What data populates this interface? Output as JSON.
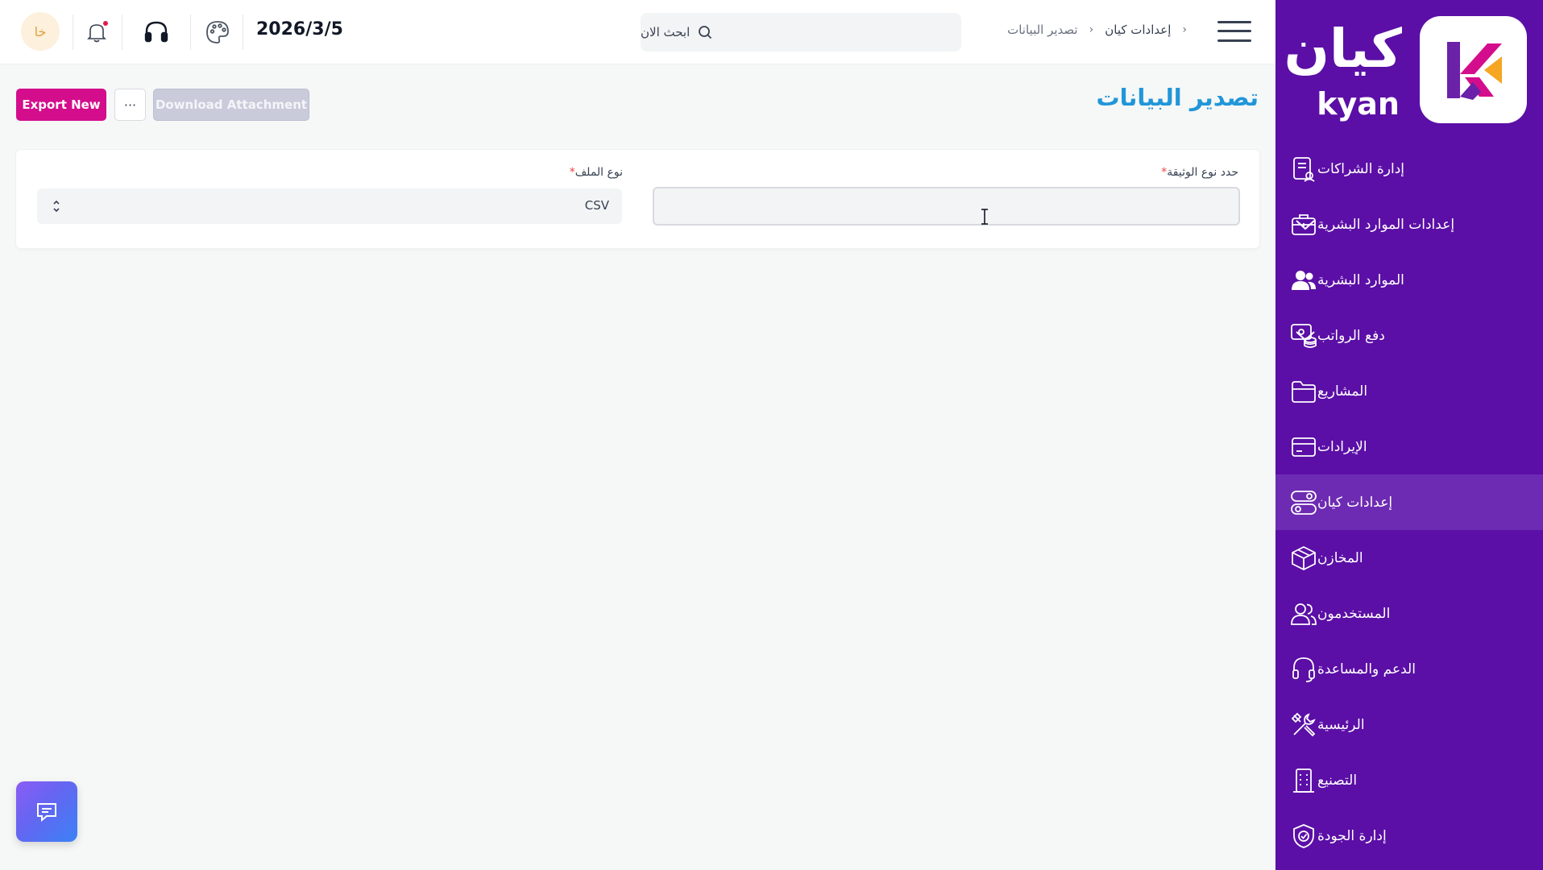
{
  "brand": {
    "name_ar": "كيان",
    "name_en": "kyan",
    "colors": {
      "sidebar": "#5b0fa6",
      "active_item": "#6d2bb3",
      "accent_pink": "#d40d8c",
      "accent_orange": "#f5a623",
      "title_blue": "#2196d9"
    }
  },
  "sidebar": {
    "items": [
      {
        "label": "إدارة الشراكات",
        "icon": "document-user-icon",
        "expandable": false,
        "active": false
      },
      {
        "label": "إعدادات الموارد البشرية",
        "icon": "briefcase-icon",
        "expandable": true,
        "active": false
      },
      {
        "label": "الموارد البشرية",
        "icon": "users-icon",
        "expandable": false,
        "active": false
      },
      {
        "label": "دفع الرواتب",
        "icon": "payroll-icon",
        "expandable": true,
        "active": false
      },
      {
        "label": "المشاريع",
        "icon": "folder-icon",
        "expandable": false,
        "active": false
      },
      {
        "label": "الإيرادات",
        "icon": "credit-card-icon",
        "expandable": false,
        "active": false
      },
      {
        "label": "إعدادات كيان",
        "icon": "toggles-icon",
        "expandable": false,
        "active": true
      },
      {
        "label": "المخازن",
        "icon": "box-icon",
        "expandable": false,
        "active": false
      },
      {
        "label": "المستخدمون",
        "icon": "user-group-icon",
        "expandable": false,
        "active": false
      },
      {
        "label": "الدعم والمساعدة",
        "icon": "headset-icon",
        "expandable": false,
        "active": false
      },
      {
        "label": "الرئيسية",
        "icon": "tools-icon",
        "expandable": false,
        "active": false
      },
      {
        "label": "التصنيع",
        "icon": "building-icon",
        "expandable": false,
        "active": false
      },
      {
        "label": "إدارة الجودة",
        "icon": "shield-check-icon",
        "expandable": false,
        "active": false
      }
    ]
  },
  "topbar": {
    "breadcrumb": {
      "parent": "إعدادات كيان",
      "current": "تصدير البيانات"
    },
    "search": {
      "placeholder": "ابحث الان"
    },
    "date": "2026/3/5",
    "avatar_initials": "خا"
  },
  "page": {
    "title": "تصدير البيانات",
    "export_new_label": "Export New",
    "more_label": "···",
    "download_label": "Download Attachment"
  },
  "form": {
    "doc_type_label": "حدد نوع الوثيقة",
    "doc_type_value": "",
    "file_type_label": "نوع الملف",
    "file_type_value": "CSV",
    "required_marker": "*"
  }
}
